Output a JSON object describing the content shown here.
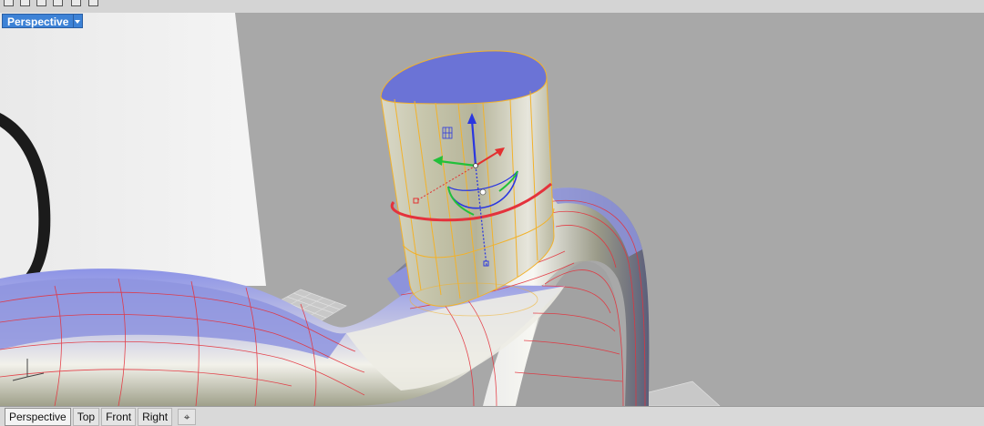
{
  "viewport": {
    "title": "Perspective",
    "menu_icon": "triangle-down-icon"
  },
  "tabs": [
    {
      "label": "Perspective",
      "active": true
    },
    {
      "label": "Top",
      "active": false
    },
    {
      "label": "Front",
      "active": false
    },
    {
      "label": "Right",
      "active": false
    }
  ],
  "add_tab_icon": "plus-icon",
  "colors": {
    "viewport_bg": "#a8a8a8",
    "active_title": "#3d82d6",
    "isocurve": "#e4323c",
    "selection": "#f2b22b",
    "gumball_x": "#e33030",
    "gumball_y": "#22c03a",
    "gumball_z": "#2a37e0"
  }
}
